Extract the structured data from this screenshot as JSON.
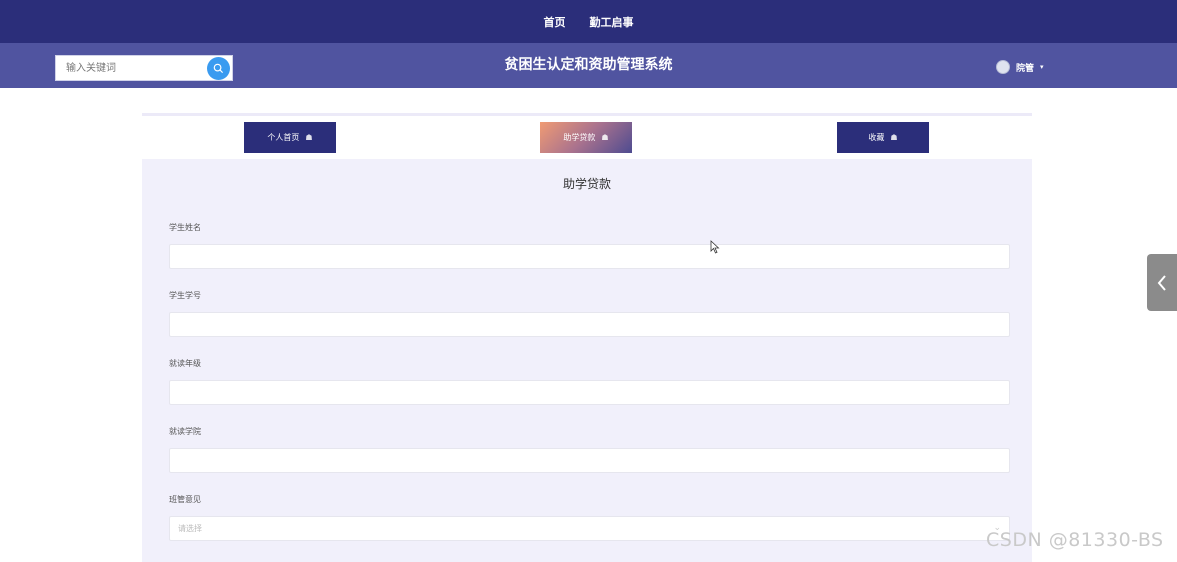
{
  "topnav": {
    "items": [
      "首页",
      "勤工启事"
    ]
  },
  "header": {
    "search_placeholder": "输入关键词",
    "site_title": "贫困生认定和资助管理系统",
    "user_name": "院管"
  },
  "tabs": [
    {
      "label": "个人首页",
      "active": false
    },
    {
      "label": "助学贷款",
      "active": true
    },
    {
      "label": "收藏",
      "active": false
    }
  ],
  "form": {
    "title": "助学贷款",
    "fields": [
      {
        "label": "学生姓名",
        "value": ""
      },
      {
        "label": "学生学号",
        "value": ""
      },
      {
        "label": "就读年级",
        "value": ""
      },
      {
        "label": "就读学院",
        "value": ""
      },
      {
        "label": "班管意见",
        "placeholder": "请选择",
        "type": "select"
      }
    ]
  },
  "watermark": "CSDN @81330-BS",
  "colors": {
    "nav": "#2b2e7a",
    "header": "#5054a0",
    "panel": "#f1f0fb",
    "search_button": "#3a9bf0"
  }
}
